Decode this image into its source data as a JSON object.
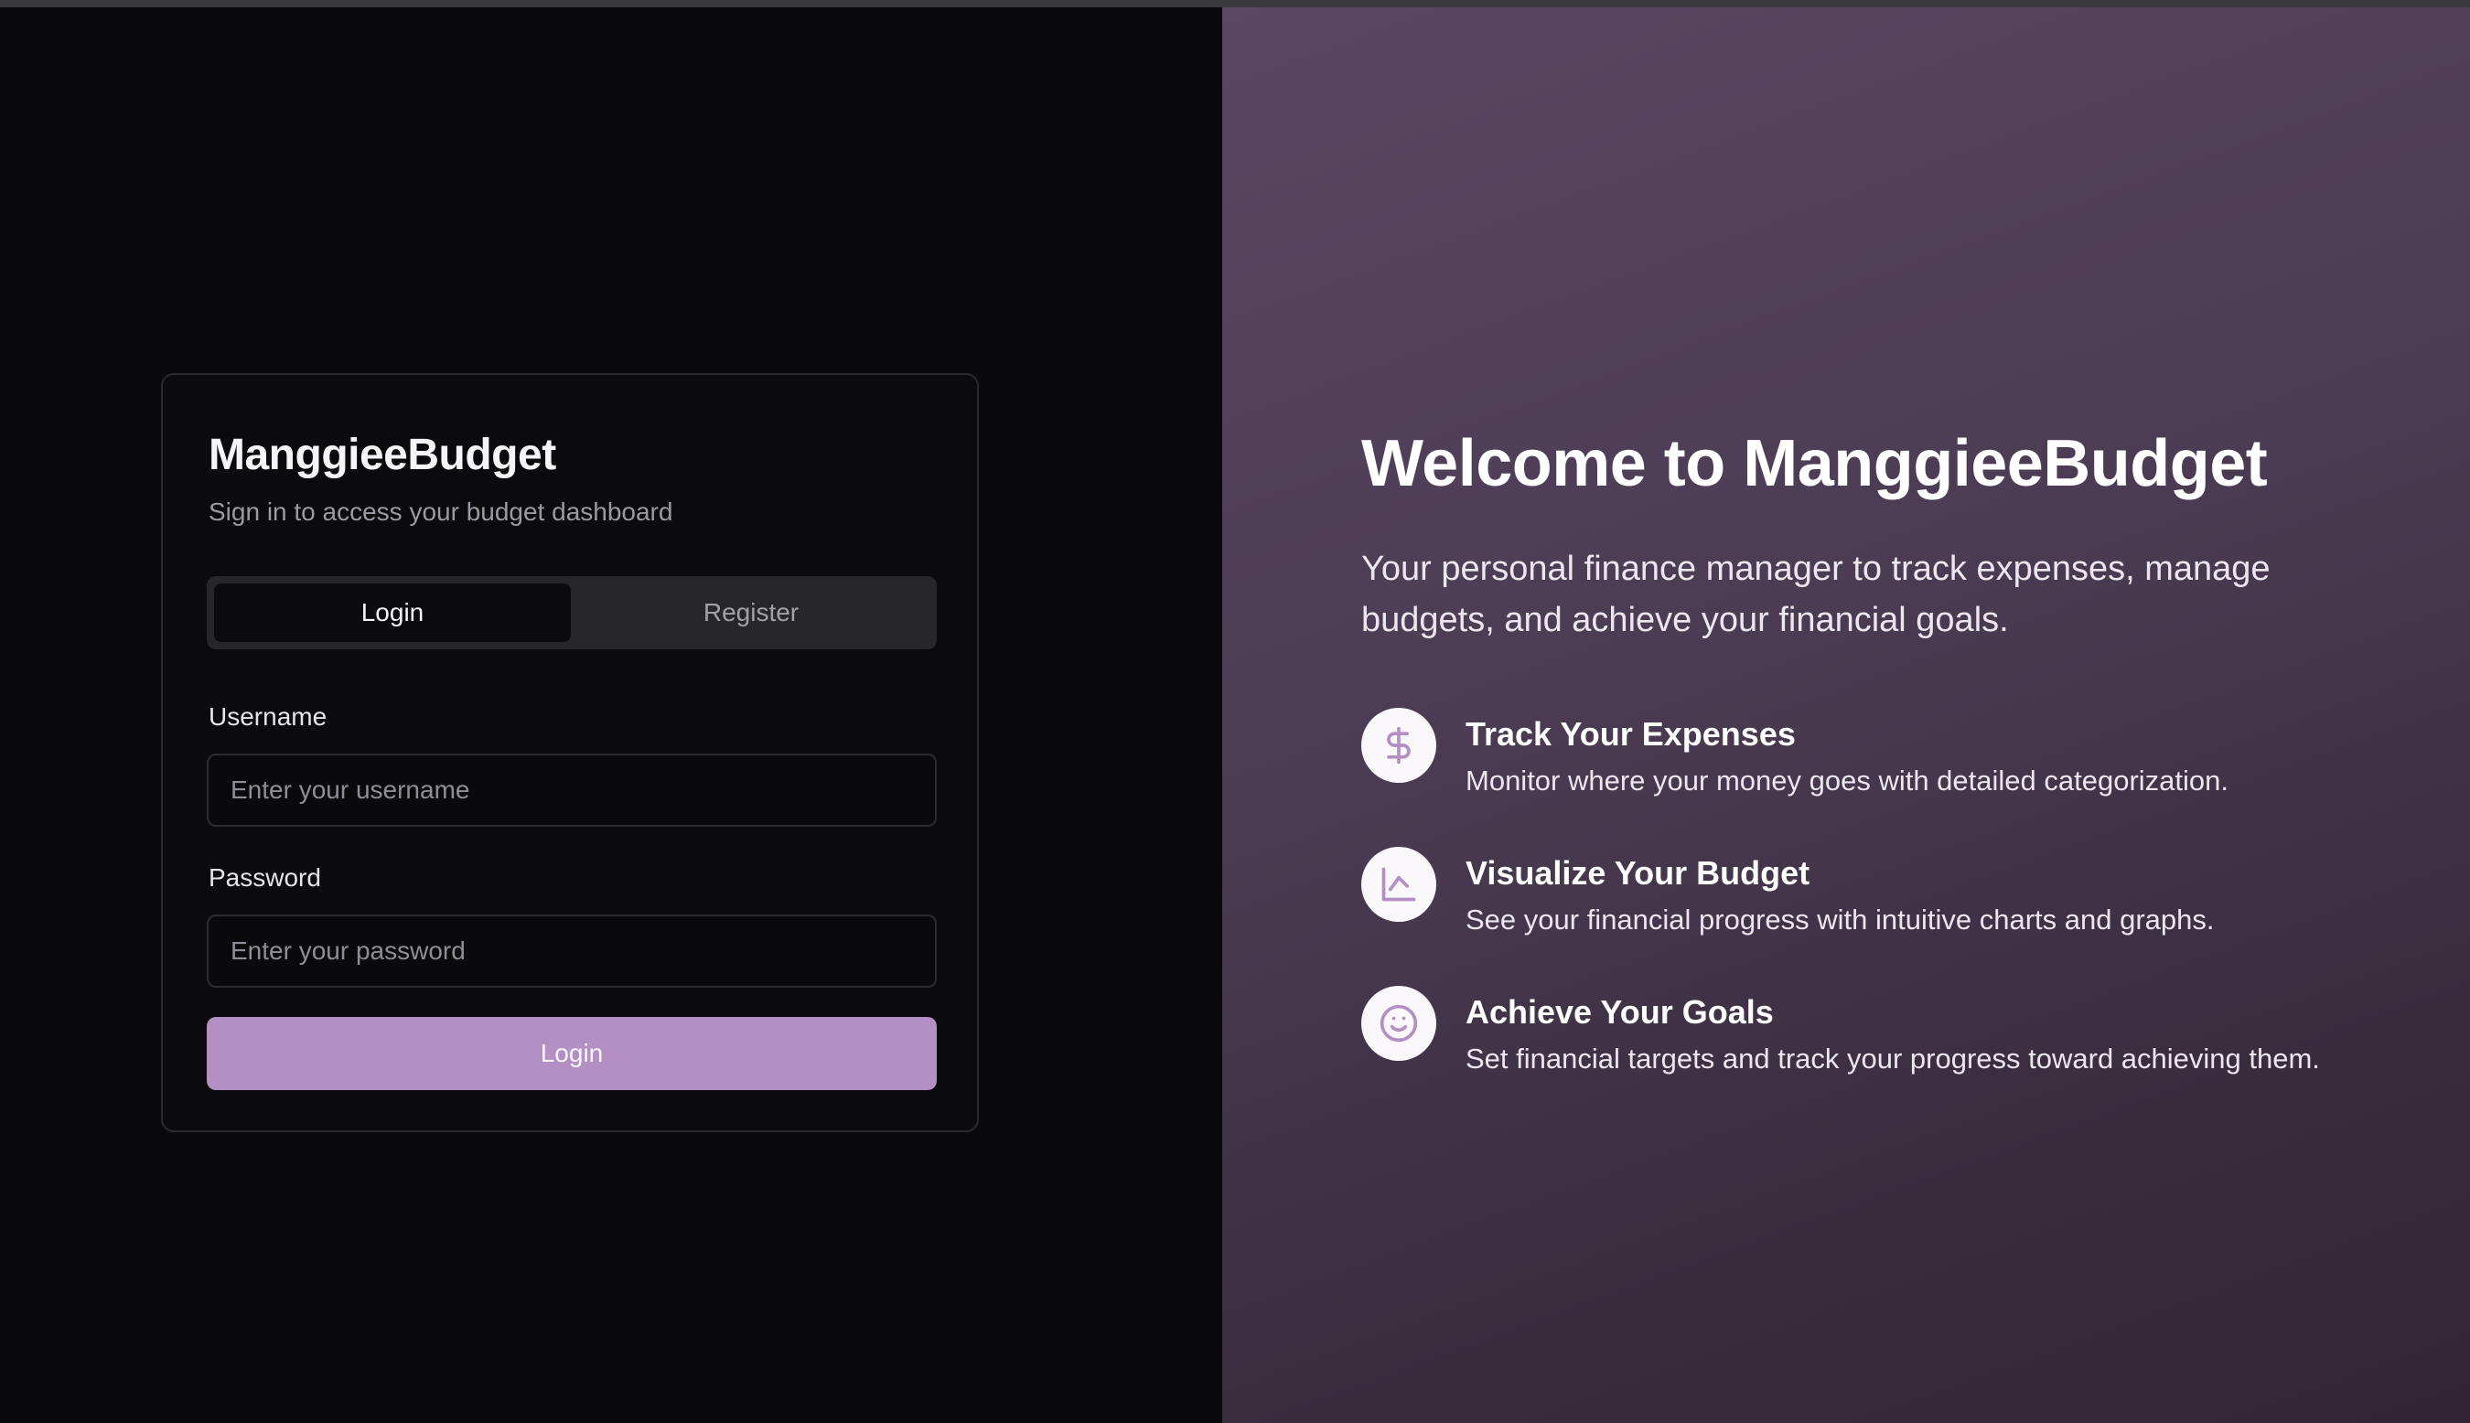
{
  "login_card": {
    "brand": "ManggieeBudget",
    "subtitle": "Sign in to access your budget dashboard",
    "tabs": [
      {
        "label": "Login",
        "active": true
      },
      {
        "label": "Register",
        "active": false
      }
    ],
    "username": {
      "label": "Username",
      "placeholder": "Enter your username",
      "value": ""
    },
    "password": {
      "label": "Password",
      "placeholder": "Enter your password",
      "value": ""
    },
    "submit_label": "Login"
  },
  "hero": {
    "title": "Welcome to ManggieeBudget",
    "tagline": "Your personal finance manager to track expenses, manage budgets, and achieve your financial goals.",
    "features": [
      {
        "icon": "dollar-icon",
        "title": "Track Your Expenses",
        "description": "Monitor where your money goes with detailed categorization."
      },
      {
        "icon": "chart-icon",
        "title": "Visualize Your Budget",
        "description": "See your financial progress with intuitive charts and graphs."
      },
      {
        "icon": "smile-icon",
        "title": "Achieve Your Goals",
        "description": "Set financial targets and track your progress toward achieving them."
      }
    ]
  },
  "colors": {
    "accent": "#b48fc4",
    "background": "#0a0a0c",
    "hero_gradient_start": "#5b4663",
    "hero_gradient_end": "#302634"
  }
}
